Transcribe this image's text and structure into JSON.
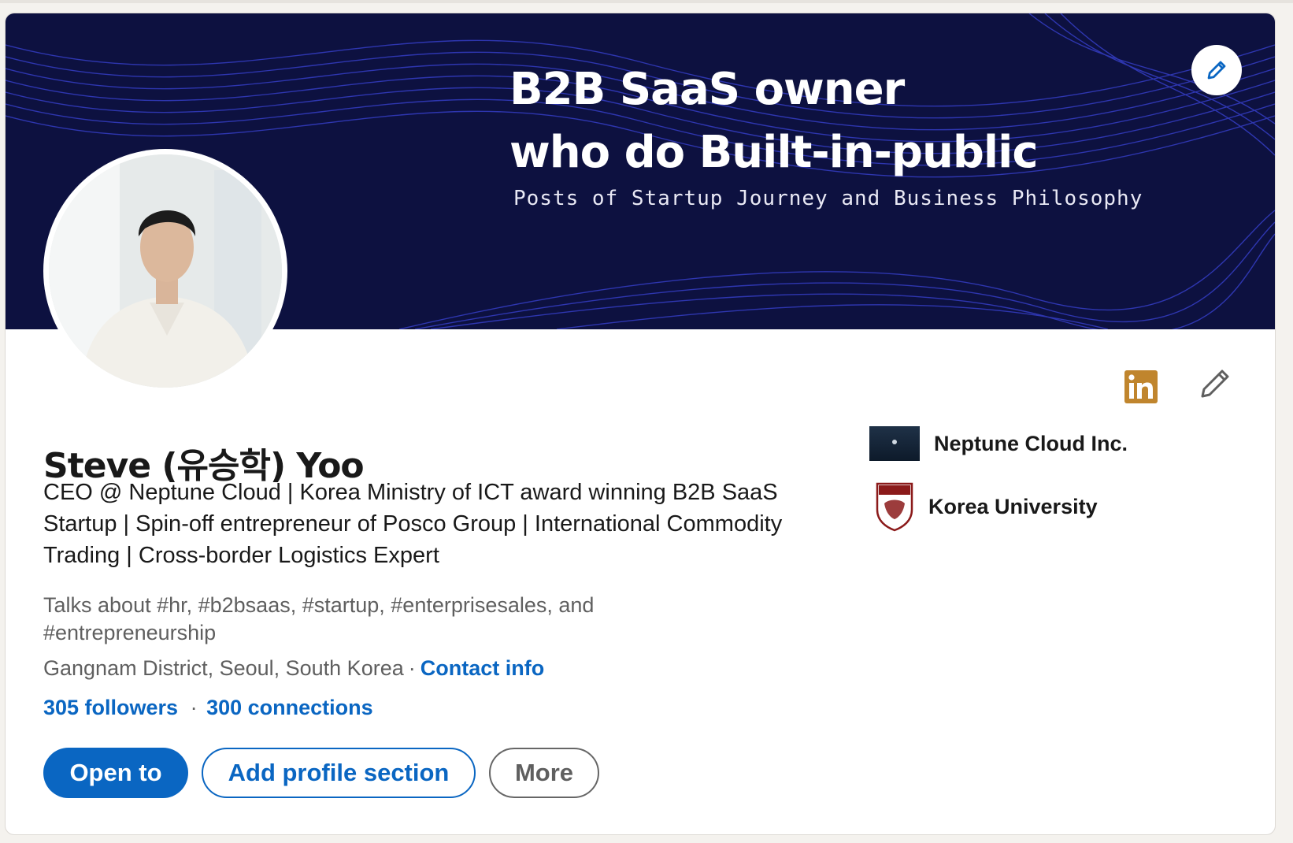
{
  "banner": {
    "line1": "B2B SaaS owner",
    "line2": "who do Built-in-public",
    "subtitle": "Posts of Startup Journey and Business Philosophy"
  },
  "profile": {
    "name": "Steve (유승학) Yoo",
    "headline": "CEO @ Neptune Cloud | Korea Ministry of ICT award winning B2B SaaS Startup | Spin-off entrepreneur of Posco Group | International Commodity Trading | Cross-border Logistics Expert",
    "talks_about": "Talks about #hr, #b2bsaas, #startup, #enterprisesales, and #entrepreneurship",
    "location": "Gangnam District, Seoul, South Korea",
    "location_separator": "·",
    "contact_info": "Contact info",
    "followers": "305 followers",
    "network_separator": "·",
    "connections": "300 connections"
  },
  "actions": {
    "open_to": "Open to",
    "add_section": "Add profile section",
    "more": "More"
  },
  "organizations": [
    {
      "name": "Neptune Cloud Inc.",
      "logo": "neptune-cloud-logo"
    },
    {
      "name": "Korea University",
      "logo": "korea-university-logo"
    }
  ],
  "icons": {
    "banner_edit": "pencil-icon",
    "linkedin": "linkedin-icon",
    "intro_edit": "pencil-icon"
  },
  "colors": {
    "brand_blue": "#0a66c2",
    "banner_bg": "#0d1140",
    "linkedin_badge": "#c0852d",
    "text_primary": "#191919",
    "text_secondary": "#5f5f5f"
  }
}
